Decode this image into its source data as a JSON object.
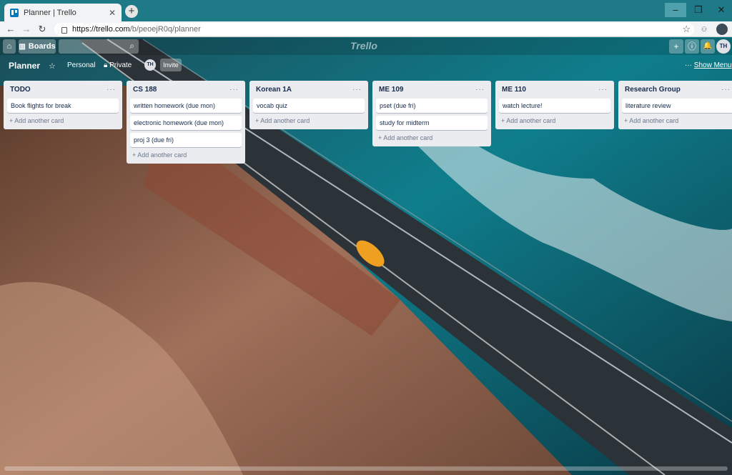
{
  "browser": {
    "tab_title": "Planner | Trello",
    "tab_close": "✕",
    "new_tab": "+",
    "url_host": "https://trello.com",
    "url_path": "/b/peoejR0q/planner",
    "window_controls": {
      "minimize": "–",
      "maximize": "❐",
      "close": "✕"
    },
    "icons": {
      "back": "arrow-left-icon",
      "forward": "arrow-right-icon",
      "reload": "reload-icon",
      "lock": "lock-icon",
      "star": "star-icon",
      "extension": "extension-icon",
      "profile": "profile-icon"
    }
  },
  "header": {
    "home_icon": "⌂",
    "boards_label": "Boards",
    "search_icon": "⌕",
    "logo": "Trello",
    "add_icon": "+",
    "info_icon": "ⓘ",
    "bell_icon": "🔔",
    "avatar_initials": "TH"
  },
  "board": {
    "title": "Planner",
    "star_icon": "☆",
    "team": "Personal",
    "visibility": "Private",
    "member_initials": "TH",
    "invite_label": "Invite",
    "show_menu_dots": "···",
    "show_menu_label": "Show Menu"
  },
  "lists": [
    {
      "title": "TODO",
      "cards": [
        "Book flights for break"
      ],
      "add_label": "+ Add another card"
    },
    {
      "title": "CS 188",
      "cards": [
        "written homework (due mon)",
        "electronic homework (due mon)",
        "proj 3 (due fri)"
      ],
      "add_label": "+ Add another card"
    },
    {
      "title": "Korean 1A",
      "cards": [
        "vocab quiz"
      ],
      "add_label": "+ Add another card"
    },
    {
      "title": "ME 109",
      "cards": [
        "pset (due fri)",
        "study for midterm"
      ],
      "add_label": "+ Add another card"
    },
    {
      "title": "ME 110",
      "cards": [
        "watch lecture!"
      ],
      "add_label": "+ Add another card"
    },
    {
      "title": "Research Group",
      "cards": [
        "literature review"
      ],
      "add_label": "+ Add another card"
    }
  ],
  "list_menu": "···",
  "colors": {
    "titlebar": "#1f7a88",
    "list_bg": "#ebecf0",
    "card_bg": "#ffffff",
    "text": "#172b4d"
  }
}
